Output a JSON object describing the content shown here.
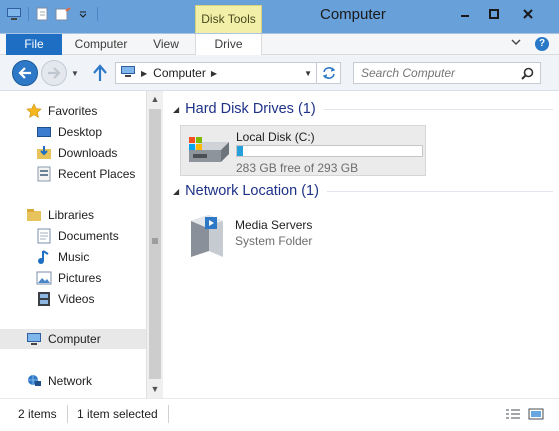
{
  "window": {
    "title": "Computer",
    "contextual_tab_group": "Disk Tools",
    "controls": [
      "minimize",
      "maximize",
      "close"
    ]
  },
  "ribbon": {
    "tabs": [
      "File",
      "Computer",
      "View",
      "Drive"
    ],
    "active_contextual_tab": "Drive"
  },
  "address_bar": {
    "location": "Computer"
  },
  "search": {
    "placeholder": "Search Computer"
  },
  "nav_pane": {
    "favorites_label": "Favorites",
    "favorites": [
      "Desktop",
      "Downloads",
      "Recent Places"
    ],
    "libraries_label": "Libraries",
    "libraries": [
      "Documents",
      "Music",
      "Pictures",
      "Videos"
    ],
    "computer_label": "Computer",
    "network_label": "Network"
  },
  "content": {
    "hard_disk_group": "Hard Disk Drives (1)",
    "drive": {
      "name": "Local Disk (C:)",
      "free_text": "283 GB free of 293 GB",
      "used_fraction": 0.034
    },
    "network_group": "Network Location (1)",
    "network_item": {
      "name": "Media Servers",
      "type": "System Folder"
    }
  },
  "status_bar": {
    "items_count": "2 items",
    "selection": "1 item selected"
  },
  "colors": {
    "accent": "#1e6fc3",
    "group_header": "#1e3287",
    "drive_bar": "#26a0da"
  }
}
